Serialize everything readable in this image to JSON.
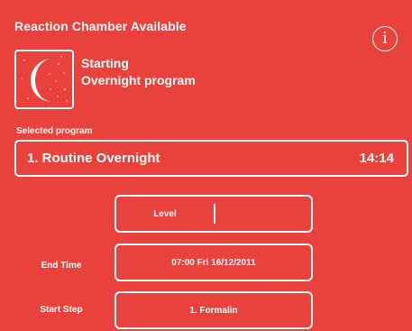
{
  "header": {
    "title": "Reaction Chamber Available",
    "info_icon": "info-icon",
    "info_glyph": "i"
  },
  "status": {
    "icon": "moon-icon",
    "line1": "Starting",
    "line2": "Overnight program"
  },
  "program": {
    "section_label": "Selected program",
    "name": "1. Routine Overnight",
    "duration": "14:14"
  },
  "settings": {
    "level_label": "Level",
    "level_value": "",
    "end_time_label": "End Time",
    "end_time_value": "07:00 Fri 16/12/2011",
    "start_step_label": "Start Step",
    "start_step_value": "1. Formalin"
  },
  "colors": {
    "background": "#e9413b",
    "foreground": "#ffffff"
  }
}
